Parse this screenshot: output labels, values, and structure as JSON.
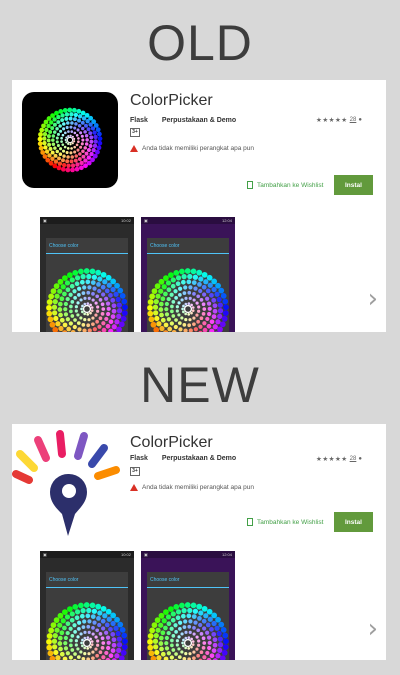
{
  "sections": [
    {
      "heading": "OLD",
      "app": {
        "title": "ColorPicker",
        "developer": "Flask",
        "category": "Perpustakaan & Demo",
        "content_badge": "3+",
        "warning": "Anda tidak memiliki perangkat apa pun",
        "rating_stars": "★★★★★",
        "rating_count": "28",
        "wishlist_label": "Tambahkan ke Wishlist",
        "install_label": "Instal",
        "icon": "color-wheel-dots-icon"
      },
      "screenshots": [
        {
          "time": "10:02",
          "dialog_title": "Choose color",
          "theme": "dark"
        },
        {
          "time": "12:04",
          "dialog_title": "Choose color",
          "theme": "purple"
        }
      ]
    },
    {
      "heading": "NEW",
      "app": {
        "title": "ColorPicker",
        "developer": "Flask",
        "category": "Perpustakaan & Demo",
        "content_badge": "3+",
        "warning": "Anda tidak memiliki perangkat apa pun",
        "rating_stars": "★★★★★",
        "rating_count": "28",
        "wishlist_label": "Tambahkan ke Wishlist",
        "install_label": "Instal",
        "icon": "color-rays-pin-logo-icon"
      },
      "screenshots": [
        {
          "time": "10:02",
          "dialog_title": "Choose color",
          "theme": "dark"
        },
        {
          "time": "12:04",
          "dialog_title": "Choose color",
          "theme": "purple"
        }
      ]
    }
  ],
  "colors": {
    "background": "#d8d8d8",
    "install_green": "#629a3c",
    "wishlist_green": "#43a047",
    "warning_red": "#d93025",
    "dialog_accent": "#4fc3f7"
  }
}
